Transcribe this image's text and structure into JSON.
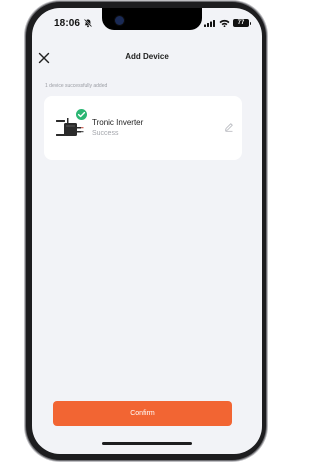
{
  "status_bar": {
    "time": "18:06",
    "battery": "77"
  },
  "header": {
    "title": "Add Device"
  },
  "info": {
    "text": "1 device successfully added"
  },
  "device": {
    "name": "Tronic Inverter",
    "status": "Success"
  },
  "actions": {
    "confirm_label": "Confirm"
  },
  "colors": {
    "accent": "#f26533",
    "success": "#2bb673",
    "screen_background": "#f2f3f7"
  },
  "icons": {
    "close": "close-icon",
    "device": "inverter-icon",
    "check": "check-icon",
    "edit": "pencil-icon",
    "notification": "bell-slash-icon",
    "signal": "cellular-signal-icon",
    "wifi": "wifi-icon"
  }
}
